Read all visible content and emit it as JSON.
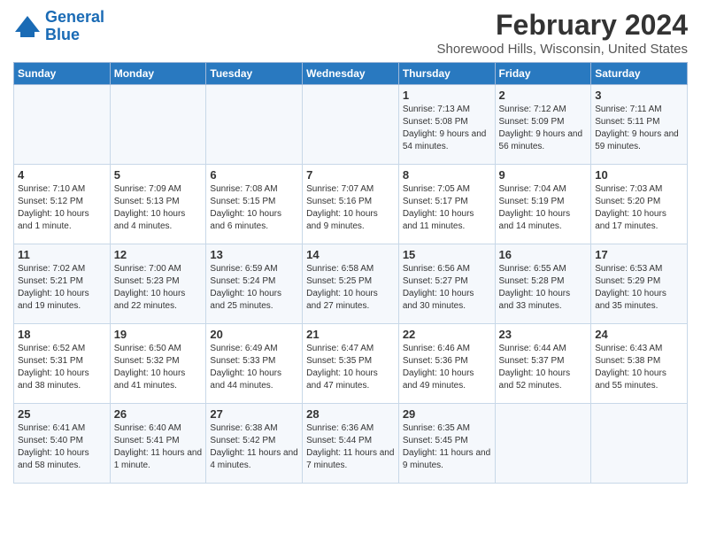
{
  "logo": {
    "line1": "General",
    "line2": "Blue"
  },
  "title": "February 2024",
  "subtitle": "Shorewood Hills, Wisconsin, United States",
  "days_of_week": [
    "Sunday",
    "Monday",
    "Tuesday",
    "Wednesday",
    "Thursday",
    "Friday",
    "Saturday"
  ],
  "weeks": [
    [
      {
        "day": "",
        "info": ""
      },
      {
        "day": "",
        "info": ""
      },
      {
        "day": "",
        "info": ""
      },
      {
        "day": "",
        "info": ""
      },
      {
        "day": "1",
        "info": "Sunrise: 7:13 AM\nSunset: 5:08 PM\nDaylight: 9 hours and 54 minutes."
      },
      {
        "day": "2",
        "info": "Sunrise: 7:12 AM\nSunset: 5:09 PM\nDaylight: 9 hours and 56 minutes."
      },
      {
        "day": "3",
        "info": "Sunrise: 7:11 AM\nSunset: 5:11 PM\nDaylight: 9 hours and 59 minutes."
      }
    ],
    [
      {
        "day": "4",
        "info": "Sunrise: 7:10 AM\nSunset: 5:12 PM\nDaylight: 10 hours and 1 minute."
      },
      {
        "day": "5",
        "info": "Sunrise: 7:09 AM\nSunset: 5:13 PM\nDaylight: 10 hours and 4 minutes."
      },
      {
        "day": "6",
        "info": "Sunrise: 7:08 AM\nSunset: 5:15 PM\nDaylight: 10 hours and 6 minutes."
      },
      {
        "day": "7",
        "info": "Sunrise: 7:07 AM\nSunset: 5:16 PM\nDaylight: 10 hours and 9 minutes."
      },
      {
        "day": "8",
        "info": "Sunrise: 7:05 AM\nSunset: 5:17 PM\nDaylight: 10 hours and 11 minutes."
      },
      {
        "day": "9",
        "info": "Sunrise: 7:04 AM\nSunset: 5:19 PM\nDaylight: 10 hours and 14 minutes."
      },
      {
        "day": "10",
        "info": "Sunrise: 7:03 AM\nSunset: 5:20 PM\nDaylight: 10 hours and 17 minutes."
      }
    ],
    [
      {
        "day": "11",
        "info": "Sunrise: 7:02 AM\nSunset: 5:21 PM\nDaylight: 10 hours and 19 minutes."
      },
      {
        "day": "12",
        "info": "Sunrise: 7:00 AM\nSunset: 5:23 PM\nDaylight: 10 hours and 22 minutes."
      },
      {
        "day": "13",
        "info": "Sunrise: 6:59 AM\nSunset: 5:24 PM\nDaylight: 10 hours and 25 minutes."
      },
      {
        "day": "14",
        "info": "Sunrise: 6:58 AM\nSunset: 5:25 PM\nDaylight: 10 hours and 27 minutes."
      },
      {
        "day": "15",
        "info": "Sunrise: 6:56 AM\nSunset: 5:27 PM\nDaylight: 10 hours and 30 minutes."
      },
      {
        "day": "16",
        "info": "Sunrise: 6:55 AM\nSunset: 5:28 PM\nDaylight: 10 hours and 33 minutes."
      },
      {
        "day": "17",
        "info": "Sunrise: 6:53 AM\nSunset: 5:29 PM\nDaylight: 10 hours and 35 minutes."
      }
    ],
    [
      {
        "day": "18",
        "info": "Sunrise: 6:52 AM\nSunset: 5:31 PM\nDaylight: 10 hours and 38 minutes."
      },
      {
        "day": "19",
        "info": "Sunrise: 6:50 AM\nSunset: 5:32 PM\nDaylight: 10 hours and 41 minutes."
      },
      {
        "day": "20",
        "info": "Sunrise: 6:49 AM\nSunset: 5:33 PM\nDaylight: 10 hours and 44 minutes."
      },
      {
        "day": "21",
        "info": "Sunrise: 6:47 AM\nSunset: 5:35 PM\nDaylight: 10 hours and 47 minutes."
      },
      {
        "day": "22",
        "info": "Sunrise: 6:46 AM\nSunset: 5:36 PM\nDaylight: 10 hours and 49 minutes."
      },
      {
        "day": "23",
        "info": "Sunrise: 6:44 AM\nSunset: 5:37 PM\nDaylight: 10 hours and 52 minutes."
      },
      {
        "day": "24",
        "info": "Sunrise: 6:43 AM\nSunset: 5:38 PM\nDaylight: 10 hours and 55 minutes."
      }
    ],
    [
      {
        "day": "25",
        "info": "Sunrise: 6:41 AM\nSunset: 5:40 PM\nDaylight: 10 hours and 58 minutes."
      },
      {
        "day": "26",
        "info": "Sunrise: 6:40 AM\nSunset: 5:41 PM\nDaylight: 11 hours and 1 minute."
      },
      {
        "day": "27",
        "info": "Sunrise: 6:38 AM\nSunset: 5:42 PM\nDaylight: 11 hours and 4 minutes."
      },
      {
        "day": "28",
        "info": "Sunrise: 6:36 AM\nSunset: 5:44 PM\nDaylight: 11 hours and 7 minutes."
      },
      {
        "day": "29",
        "info": "Sunrise: 6:35 AM\nSunset: 5:45 PM\nDaylight: 11 hours and 9 minutes."
      },
      {
        "day": "",
        "info": ""
      },
      {
        "day": "",
        "info": ""
      }
    ]
  ]
}
